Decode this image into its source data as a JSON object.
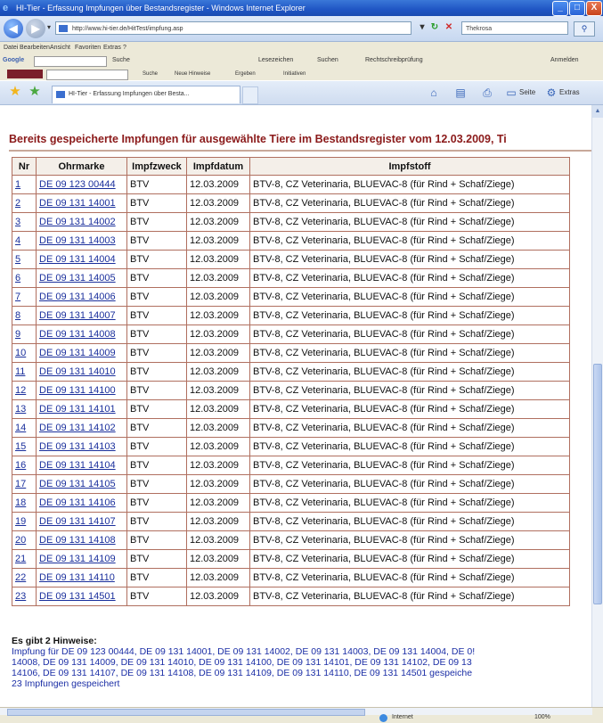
{
  "window": {
    "title": "HI-Tier - Erfassung Impfungen über Bestandsregister - Windows Internet Explorer",
    "tab_label": "HI-Tier - Erfassung Impfungen über Besta...",
    "address": "http://www.hi-tier.de/HitTest/impfung.asp",
    "search_value": "Thekrosa",
    "controls": {
      "minimize": "_",
      "maximize": "□",
      "close": "X"
    }
  },
  "menu": [
    "Datei",
    "Bearbeiten",
    "Ansicht",
    "Favoriten",
    "Extras",
    "?"
  ],
  "google_toolbar": {
    "logo": "Google",
    "items": [
      "Suche",
      "Lesezeichen",
      "Suchen",
      "Rechtschreibprüfung",
      "Anmelden"
    ]
  },
  "links_toolbar": {
    "items": [
      "Suche",
      "Neue Hinweise",
      "Ergeben",
      "Initiativen"
    ]
  },
  "command_bar": {
    "items": [
      "Seite",
      "Extras"
    ]
  },
  "content": {
    "heading": "Bereits gespeicherte Impfungen für ausgewählte Tiere im Bestandsregister vom 12.03.2009, Ti",
    "columns": [
      "Nr",
      "Ohrmarke",
      "Impfzweck",
      "Impfdatum",
      "Impfstoff"
    ],
    "rows": [
      {
        "nr": "1",
        "ohrmarke": "DE 09 123 00444",
        "zweck": "BTV",
        "datum": "12.03.2009",
        "stoff": "BTV-8, CZ Veterinaria, BLUEVAC-8 (für Rind + Schaf/Ziege)"
      },
      {
        "nr": "2",
        "ohrmarke": "DE 09 131 14001",
        "zweck": "BTV",
        "datum": "12.03.2009",
        "stoff": "BTV-8, CZ Veterinaria, BLUEVAC-8 (für Rind + Schaf/Ziege)"
      },
      {
        "nr": "3",
        "ohrmarke": "DE 09 131 14002",
        "zweck": "BTV",
        "datum": "12.03.2009",
        "stoff": "BTV-8, CZ Veterinaria, BLUEVAC-8 (für Rind + Schaf/Ziege)"
      },
      {
        "nr": "4",
        "ohrmarke": "DE 09 131 14003",
        "zweck": "BTV",
        "datum": "12.03.2009",
        "stoff": "BTV-8, CZ Veterinaria, BLUEVAC-8 (für Rind + Schaf/Ziege)"
      },
      {
        "nr": "5",
        "ohrmarke": "DE 09 131 14004",
        "zweck": "BTV",
        "datum": "12.03.2009",
        "stoff": "BTV-8, CZ Veterinaria, BLUEVAC-8 (für Rind + Schaf/Ziege)"
      },
      {
        "nr": "6",
        "ohrmarke": "DE 09 131 14005",
        "zweck": "BTV",
        "datum": "12.03.2009",
        "stoff": "BTV-8, CZ Veterinaria, BLUEVAC-8 (für Rind + Schaf/Ziege)"
      },
      {
        "nr": "7",
        "ohrmarke": "DE 09 131 14006",
        "zweck": "BTV",
        "datum": "12.03.2009",
        "stoff": "BTV-8, CZ Veterinaria, BLUEVAC-8 (für Rind + Schaf/Ziege)"
      },
      {
        "nr": "8",
        "ohrmarke": "DE 09 131 14007",
        "zweck": "BTV",
        "datum": "12.03.2009",
        "stoff": "BTV-8, CZ Veterinaria, BLUEVAC-8 (für Rind + Schaf/Ziege)"
      },
      {
        "nr": "9",
        "ohrmarke": "DE 09 131 14008",
        "zweck": "BTV",
        "datum": "12.03.2009",
        "stoff": "BTV-8, CZ Veterinaria, BLUEVAC-8 (für Rind + Schaf/Ziege)"
      },
      {
        "nr": "10",
        "ohrmarke": "DE 09 131 14009",
        "zweck": "BTV",
        "datum": "12.03.2009",
        "stoff": "BTV-8, CZ Veterinaria, BLUEVAC-8 (für Rind + Schaf/Ziege)"
      },
      {
        "nr": "11",
        "ohrmarke": "DE 09 131 14010",
        "zweck": "BTV",
        "datum": "12.03.2009",
        "stoff": "BTV-8, CZ Veterinaria, BLUEVAC-8 (für Rind + Schaf/Ziege)"
      },
      {
        "nr": "12",
        "ohrmarke": "DE 09 131 14100",
        "zweck": "BTV",
        "datum": "12.03.2009",
        "stoff": "BTV-8, CZ Veterinaria, BLUEVAC-8 (für Rind + Schaf/Ziege)"
      },
      {
        "nr": "13",
        "ohrmarke": "DE 09 131 14101",
        "zweck": "BTV",
        "datum": "12.03.2009",
        "stoff": "BTV-8, CZ Veterinaria, BLUEVAC-8 (für Rind + Schaf/Ziege)"
      },
      {
        "nr": "14",
        "ohrmarke": "DE 09 131 14102",
        "zweck": "BTV",
        "datum": "12.03.2009",
        "stoff": "BTV-8, CZ Veterinaria, BLUEVAC-8 (für Rind + Schaf/Ziege)"
      },
      {
        "nr": "15",
        "ohrmarke": "DE 09 131 14103",
        "zweck": "BTV",
        "datum": "12.03.2009",
        "stoff": "BTV-8, CZ Veterinaria, BLUEVAC-8 (für Rind + Schaf/Ziege)"
      },
      {
        "nr": "16",
        "ohrmarke": "DE 09 131 14104",
        "zweck": "BTV",
        "datum": "12.03.2009",
        "stoff": "BTV-8, CZ Veterinaria, BLUEVAC-8 (für Rind + Schaf/Ziege)"
      },
      {
        "nr": "17",
        "ohrmarke": "DE 09 131 14105",
        "zweck": "BTV",
        "datum": "12.03.2009",
        "stoff": "BTV-8, CZ Veterinaria, BLUEVAC-8 (für Rind + Schaf/Ziege)"
      },
      {
        "nr": "18",
        "ohrmarke": "DE 09 131 14106",
        "zweck": "BTV",
        "datum": "12.03.2009",
        "stoff": "BTV-8, CZ Veterinaria, BLUEVAC-8 (für Rind + Schaf/Ziege)"
      },
      {
        "nr": "19",
        "ohrmarke": "DE 09 131 14107",
        "zweck": "BTV",
        "datum": "12.03.2009",
        "stoff": "BTV-8, CZ Veterinaria, BLUEVAC-8 (für Rind + Schaf/Ziege)"
      },
      {
        "nr": "20",
        "ohrmarke": "DE 09 131 14108",
        "zweck": "BTV",
        "datum": "12.03.2009",
        "stoff": "BTV-8, CZ Veterinaria, BLUEVAC-8 (für Rind + Schaf/Ziege)"
      },
      {
        "nr": "21",
        "ohrmarke": "DE 09 131 14109",
        "zweck": "BTV",
        "datum": "12.03.2009",
        "stoff": "BTV-8, CZ Veterinaria, BLUEVAC-8 (für Rind + Schaf/Ziege)"
      },
      {
        "nr": "22",
        "ohrmarke": "DE 09 131 14110",
        "zweck": "BTV",
        "datum": "12.03.2009",
        "stoff": "BTV-8, CZ Veterinaria, BLUEVAC-8 (für Rind + Schaf/Ziege)"
      },
      {
        "nr": "23",
        "ohrmarke": "DE 09 131 14501",
        "zweck": "BTV",
        "datum": "12.03.2009",
        "stoff": "BTV-8, CZ Veterinaria, BLUEVAC-8 (für Rind + Schaf/Ziege)"
      }
    ],
    "hinweis_title": "Es gibt 2 Hinweise:",
    "hinweis_lines": [
      "Impfung für DE 09 123 00444, DE 09 131 14001, DE 09 131 14002, DE 09 131 14003, DE 09 131 14004, DE 0!",
      "14008, DE 09 131 14009, DE 09 131 14010, DE 09 131 14100, DE 09 131 14101, DE 09 131 14102, DE 09 13",
      "14106, DE 09 131 14107, DE 09 131 14108, DE 09 131 14109, DE 09 131 14110, DE 09 131 14501 gespeiche",
      "23 Impfungen gespeichert"
    ]
  },
  "status_bar": {
    "zone": "Internet",
    "zoom": "100%"
  }
}
